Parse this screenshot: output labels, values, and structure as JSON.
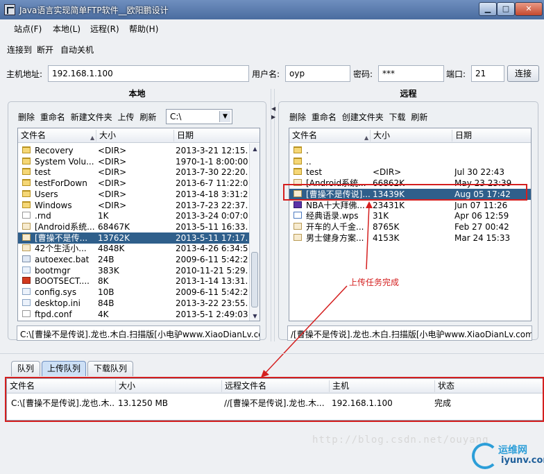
{
  "window": {
    "title": "Java语言实现简单FTP软件__欧阳鹏设计",
    "minimize_label": "▁",
    "maximize_label": "□",
    "close_label": "✕"
  },
  "menu": {
    "items": [
      "站点(F)",
      "本地(L)",
      "远程(R)",
      "帮助(H)"
    ]
  },
  "toolbar": {
    "connect": "连接到",
    "disconnect": "断开",
    "autoshutdown": "自动关机"
  },
  "connection": {
    "host_label": "主机地址:",
    "host_value": "192.168.1.100",
    "user_label": "用户名:",
    "user_value": "oyp",
    "pass_label": "密码:",
    "pass_value": "***",
    "port_label": "端口:",
    "port_value": "21",
    "connect_button": "连接"
  },
  "local": {
    "heading": "本地",
    "actions": [
      "删除",
      "重命名",
      "新建文件夹",
      "上传",
      "刷新"
    ],
    "drive": "C:\\",
    "columns": [
      "文件名",
      "大小",
      "日期"
    ],
    "rows": [
      {
        "icon": "folder-icon",
        "name": "Recovery",
        "size": "<DIR>",
        "date": "2013-3-21 12:15..."
      },
      {
        "icon": "folder-icon",
        "name": "System Volu...",
        "size": "<DIR>",
        "date": "1970-1-1 8:00:00"
      },
      {
        "icon": "folder-icon",
        "name": "test",
        "size": "<DIR>",
        "date": "2013-7-30 22:20..."
      },
      {
        "icon": "folder-icon",
        "name": "testForDown",
        "size": "<DIR>",
        "date": "2013-6-7 11:22:06"
      },
      {
        "icon": "folder-icon",
        "name": "Users",
        "size": "<DIR>",
        "date": "2013-4-18 3:31:24"
      },
      {
        "icon": "folder-icon",
        "name": "Windows",
        "size": "<DIR>",
        "date": "2013-7-23 22:37..."
      },
      {
        "icon": "file-icon",
        "name": ".rnd",
        "size": "1K",
        "date": "2013-3-24 0:07:06"
      },
      {
        "icon": "image-file-icon",
        "name": "[Android系统...",
        "size": "68467K",
        "date": "2013-5-11 16:33..."
      },
      {
        "icon": "image-file-icon",
        "name": "[曹操不是传...",
        "size": "13762K",
        "date": "2013-5-11 17:17...",
        "selected": true
      },
      {
        "icon": "image-file-icon",
        "name": "42个生活小...",
        "size": "4848K",
        "date": "2013-4-26 6:34:58"
      },
      {
        "icon": "batch-file-icon",
        "name": "autoexec.bat",
        "size": "24B",
        "date": "2009-6-11 5:42:20"
      },
      {
        "icon": "system-file-icon",
        "name": "bootmgr",
        "size": "383K",
        "date": "2010-11-21 5:29..."
      },
      {
        "icon": "red-file-icon",
        "name": "BOOTSECT....",
        "size": "8K",
        "date": "2013-1-14 13:31..."
      },
      {
        "icon": "system-file-icon",
        "name": "config.sys",
        "size": "10B",
        "date": "2009-6-11 5:42:20"
      },
      {
        "icon": "settings-file-icon",
        "name": "desktop.ini",
        "size": "84B",
        "date": "2013-3-22 23:55..."
      },
      {
        "icon": "file-icon",
        "name": "ftpd.conf",
        "size": "4K",
        "date": "2013-5-1 2:49:03"
      }
    ],
    "path": "C:\\[曹操不是传说].龙也.木白.扫描版[小电驴www.XiaoDianLv.com..."
  },
  "remote": {
    "heading": "远程",
    "actions": [
      "删除",
      "重命名",
      "创建文件夹",
      "下载",
      "刷新"
    ],
    "columns": [
      "文件名",
      "大小",
      "日期"
    ],
    "rows": [
      {
        "icon": "folder-icon",
        "name": ".",
        "size": "",
        "date": ""
      },
      {
        "icon": "folder-icon",
        "name": "..",
        "size": "",
        "date": ""
      },
      {
        "icon": "folder-icon",
        "name": "test",
        "size": "<DIR>",
        "date": "Jul 30 22:43"
      },
      {
        "icon": "image-file-icon",
        "name": "[Android系统...",
        "size": "66862K",
        "date": "May 23 23:39"
      },
      {
        "icon": "image-file-icon",
        "name": "[曹操不是传说]...",
        "size": "13439K",
        "date": "Aug 05 17:42",
        "selected": true
      },
      {
        "icon": "video-file-icon",
        "name": "NBA十大拜佛...",
        "size": "23431K",
        "date": "Jun 07 11:26"
      },
      {
        "icon": "wps-file-icon",
        "name": "经典语录.wps",
        "size": "31K",
        "date": "Apr 06 12:59"
      },
      {
        "icon": "image-file-icon",
        "name": "开车的人千金...",
        "size": "8765K",
        "date": "Feb 27 00:42"
      },
      {
        "icon": "image-file-icon",
        "name": "男士健身方案...",
        "size": "4153K",
        "date": "Mar 24 15:33"
      }
    ],
    "path": "/[曹操不是传说].龙也.木白.扫描版[小电驴www.XiaoDianLv.com].p..."
  },
  "annotation": {
    "text": "上传任务完成",
    "color": "#d41f1f"
  },
  "queue": {
    "tabs": [
      "队列",
      "上传队列",
      "下载队列"
    ],
    "active_tab": 1,
    "columns": [
      "文件名",
      "大小",
      "远程文件名",
      "主机",
      "状态"
    ],
    "rows": [
      {
        "file": "C:\\[曹操不是传说].龙也.木...",
        "size": "13.1250 MB",
        "remote": "//[曹操不是传说].龙也.木...",
        "host": "192.168.1.100",
        "status": "完成"
      }
    ]
  },
  "watermark": "http://blog.csdn.net/ouyang",
  "logo": {
    "name": "运维网",
    "site": "iyunv.com"
  },
  "colors": {
    "selection": "#2f5f8b",
    "annotation": "#d41f1f",
    "titlebar": "#4a6c9f"
  }
}
